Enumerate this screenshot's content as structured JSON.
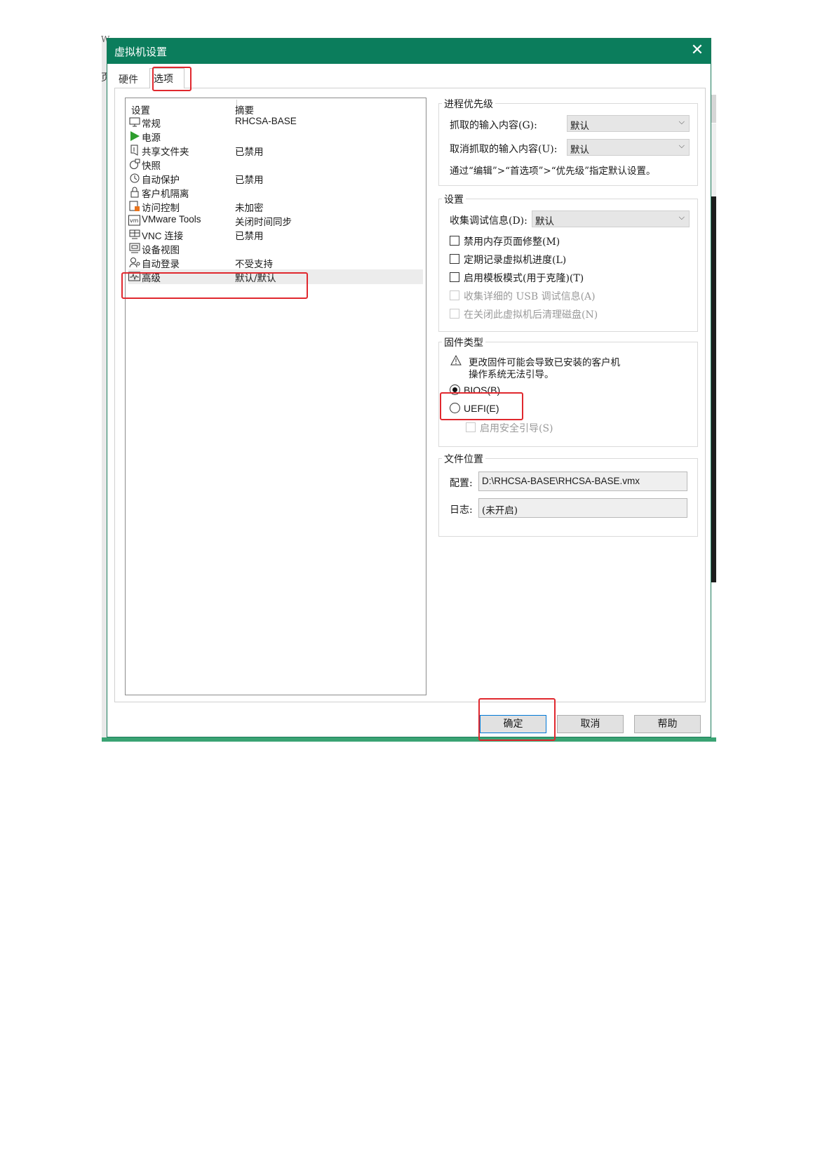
{
  "background": {
    "glyph_top": "W",
    "glyph_left": "页"
  },
  "dialog": {
    "title": "虚拟机设置",
    "close_symbol": "✕",
    "tabs": [
      {
        "label": "硬件"
      },
      {
        "label": "选项"
      }
    ]
  },
  "list": {
    "headers": {
      "setting": "设置",
      "summary": "摘要"
    },
    "items": [
      {
        "name": "常规",
        "summary": "RHCSA-BASE",
        "icon": "monitor-icon"
      },
      {
        "name": "电源",
        "summary": "",
        "icon": "play-icon"
      },
      {
        "name": "共享文件夹",
        "summary": "已禁用",
        "icon": "shared-folder-icon"
      },
      {
        "name": "快照",
        "summary": "",
        "icon": "snapshot-icon"
      },
      {
        "name": "自动保护",
        "summary": "已禁用",
        "icon": "clock-icon"
      },
      {
        "name": "客户机隔离",
        "summary": "",
        "icon": "lock-icon"
      },
      {
        "name": "访问控制",
        "summary": "未加密",
        "icon": "access-control-icon"
      },
      {
        "name": "VMware Tools",
        "summary": "关闭时间同步",
        "icon": "vm-icon"
      },
      {
        "name": "VNC 连接",
        "summary": "已禁用",
        "icon": "vnc-icon"
      },
      {
        "name": "设备视图",
        "summary": "",
        "icon": "device-view-icon"
      },
      {
        "name": "自动登录",
        "summary": "不受支持",
        "icon": "user-icon"
      },
      {
        "name": "高级",
        "summary": "默认/默认",
        "icon": "advanced-icon"
      }
    ]
  },
  "process_priority": {
    "title": "进程优先级",
    "grab_label": "抓取的输入内容(G):",
    "grab_value": "默认",
    "release_label": "取消抓取的输入内容(U):",
    "release_value": "默认",
    "note": "通过“编辑”>“首选项”>“优先级”指定默认设置。"
  },
  "settings": {
    "title": "设置",
    "debug_label": "收集调试信息(D):",
    "debug_value": "默认",
    "checkboxes": [
      {
        "label": "禁用内存页面修整(M)",
        "checked": false,
        "enabled": true
      },
      {
        "label": "定期记录虚拟机进度(L)",
        "checked": false,
        "enabled": true
      },
      {
        "label": "启用模板模式(用于克隆)(T)",
        "checked": false,
        "enabled": true
      },
      {
        "label": "收集详细的 USB 调试信息(A)",
        "checked": false,
        "enabled": false
      },
      {
        "label": "在关闭此虚拟机后清理磁盘(N)",
        "checked": false,
        "enabled": false
      }
    ]
  },
  "firmware": {
    "title": "固件类型",
    "warning_line1": "更改固件可能会导致已安装的客户机",
    "warning_line2": "操作系统无法引导。",
    "bios_label": "BIOS(B)",
    "uefi_label": "UEFI(E)",
    "selected": "BIOS",
    "secure_boot_label": "启用安全引导(S)"
  },
  "file_location": {
    "title": "文件位置",
    "config_label": "配置:",
    "config_value": "D:\\RHCSA-BASE\\RHCSA-BASE.vmx",
    "log_label": "日志:",
    "log_value": "(未开启)"
  },
  "buttons": {
    "ok": "确定",
    "cancel": "取消",
    "help": "帮助"
  },
  "colors": {
    "titlebar": "#0b7d5c",
    "annotation": "#e0282e"
  }
}
